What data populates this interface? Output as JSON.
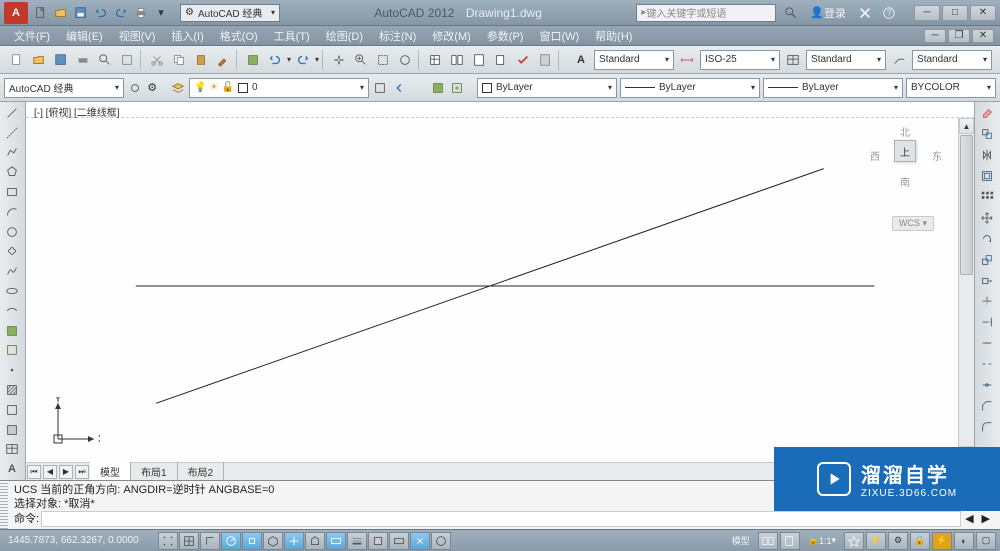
{
  "app": {
    "name": "AutoCAD 2012",
    "document": "Drawing1.dwg",
    "icon_letter": "A"
  },
  "workspace_dropdown": "AutoCAD 经典",
  "search_placeholder": "键入关键字或短语",
  "login_label": "登录",
  "menu": [
    "文件(F)",
    "编辑(E)",
    "视图(V)",
    "插入(I)",
    "格式(O)",
    "工具(T)",
    "绘图(D)",
    "标注(N)",
    "修改(M)",
    "参数(P)",
    "窗口(W)",
    "帮助(H)"
  ],
  "toolbar2": {
    "workspace": "AutoCAD 经典",
    "layer_state": "0",
    "text_style": "Standard",
    "dim_style": "ISO-25",
    "table_style": "Standard",
    "mleader_style": "Standard"
  },
  "properties_bar": {
    "color": "ByLayer",
    "linetype": "ByLayer",
    "lineweight": "ByLayer",
    "plot_style": "BYCOLOR"
  },
  "viewport_label": "[-] [俯视] [二维线框]",
  "navcube": {
    "n": "北",
    "s": "南",
    "e": "东",
    "w": "西",
    "top": "上",
    "wcs": "WCS ▾"
  },
  "ucs_axes": {
    "x": "X",
    "y": "Y"
  },
  "tabs": {
    "items": [
      "模型",
      "布局1",
      "布局2"
    ],
    "active": 0
  },
  "command": {
    "line1": "UCS 当前的正角方向:   ANGDIR=逆时针   ANGBASE=0",
    "line2": "选择对象: *取消*",
    "prompt": "命令:"
  },
  "status": {
    "coords": "1445.7873, 662.3267, 0.0000",
    "right": {
      "model": "模型",
      "scale": "1:1"
    }
  },
  "watermark": {
    "main": "溜溜自学",
    "sub": "ZIXUE.3D66.COM"
  },
  "colors": {
    "accent": "#1a6bb8",
    "app_red": "#c0392b"
  }
}
